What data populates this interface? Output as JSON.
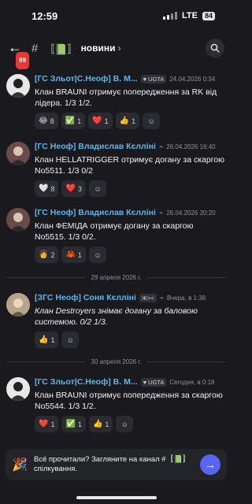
{
  "status_bar": {
    "time": "12:59",
    "network": "LTE",
    "battery": "84"
  },
  "header": {
    "back_badge": "99",
    "channel_emoji": "📗",
    "channel_name": "новини",
    "chevron": "›"
  },
  "messages": [
    {
      "author": "[ГС Зльот|С.Неоф] В. М...",
      "tag": "UGTA",
      "time": "24.04.2026 0:34",
      "text": "Клан BRAUNI отримує попередження за RK від лідера. 1/3 1/2.",
      "italic": false,
      "reactions": [
        {
          "emoji": "😂",
          "count": "8"
        },
        {
          "emoji": "✅",
          "count": "1"
        },
        {
          "emoji": "❤️",
          "count": "1"
        },
        {
          "emoji": "👍",
          "count": "1"
        }
      ]
    },
    {
      "author": "[ГС Неоф] Владислав Кєлліні",
      "tag": "",
      "time": "26.04.2026 16:40",
      "text": "Клан HELLATRIGGER отримує догану за скаргою No5511. 1/3 0/2",
      "italic": false,
      "reactions": [
        {
          "emoji": "🤍",
          "count": "8"
        },
        {
          "emoji": "❤️",
          "count": "3"
        }
      ]
    },
    {
      "author": "[ГС Неоф] Владислав Кєлліні",
      "tag": "",
      "time": "26.04.2026 20:20",
      "text": "Клан ФЕМІДА отримує догану за скаргою No5515. 1/3 0/2.",
      "italic": false,
      "reactions": [
        {
          "emoji": "👩",
          "count": "2"
        },
        {
          "emoji": "🦀",
          "count": "1"
        }
      ]
    },
    {
      "author": "[ЗГС Неоф] Соня Кєлліні",
      "tag": "Ж><",
      "time": "Вчера, в 1:38",
      "text": "Клан Destroyers знімає догану за баловою системою. 0/2 1/3.",
      "italic": true,
      "reactions": [
        {
          "emoji": "👍",
          "count": "1"
        }
      ]
    },
    {
      "author": "[ГС Зльот|С.Неоф] В. М...",
      "tag": "UGTA",
      "time": "Сегодня, в 0:18",
      "text": "Клан BRAUNI отримує попередження за скаргою No5544. 1/3 1/2.",
      "italic": false,
      "reactions": [
        {
          "emoji": "❤️",
          "count": "1"
        },
        {
          "emoji": "✅",
          "count": "1"
        },
        {
          "emoji": "👍",
          "count": "1"
        }
      ]
    }
  ],
  "dividers": [
    "29 апреля 2026 г.",
    "30 апреля 2026 г."
  ],
  "toast": {
    "text": "Всё прочитали? Загляните на канал #〚📗〛спілкування."
  }
}
